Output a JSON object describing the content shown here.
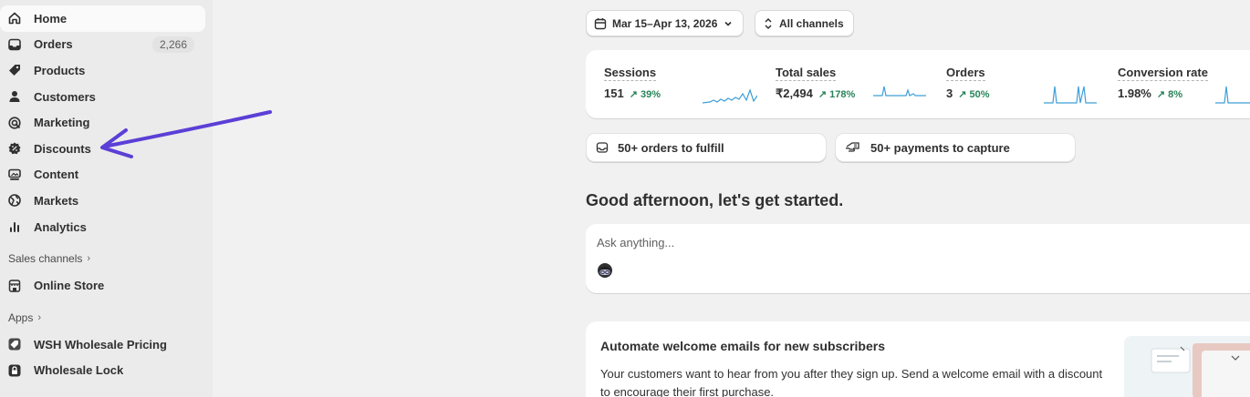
{
  "sidebar": {
    "items": [
      {
        "label": "Home",
        "icon": "home-icon"
      },
      {
        "label": "Orders",
        "icon": "inbox-icon",
        "badge": "2,266"
      },
      {
        "label": "Products",
        "icon": "tag-icon"
      },
      {
        "label": "Customers",
        "icon": "person-icon"
      },
      {
        "label": "Marketing",
        "icon": "target-icon"
      },
      {
        "label": "Discounts",
        "icon": "discount-icon"
      },
      {
        "label": "Content",
        "icon": "content-icon"
      },
      {
        "label": "Markets",
        "icon": "globe-icon"
      },
      {
        "label": "Analytics",
        "icon": "bar-chart-icon"
      }
    ],
    "sales_channels": {
      "heading": "Sales channels",
      "items": [
        {
          "label": "Online Store",
          "icon": "store-icon"
        }
      ]
    },
    "apps": {
      "heading": "Apps",
      "items": [
        {
          "label": "WSH Wholesale Pricing",
          "icon": "app-icon"
        },
        {
          "label": "Wholesale Lock",
          "icon": "lock-icon"
        }
      ]
    }
  },
  "filters": {
    "date": "Mar 15–Apr 13, 2026",
    "channels": "All channels"
  },
  "metrics": [
    {
      "label": "Sessions",
      "value": "151",
      "delta": "39%"
    },
    {
      "label": "Total sales",
      "value": "₹2,494",
      "delta": "178%"
    },
    {
      "label": "Orders",
      "value": "3",
      "delta": "50%"
    },
    {
      "label": "Conversion rate",
      "value": "1.98%",
      "delta": "8%"
    }
  ],
  "tasks": {
    "orders": "50+ orders to fulfill",
    "payments": "50+ payments to capture"
  },
  "greeting": "Good afternoon, let's get started.",
  "ask": {
    "placeholder": "Ask anything..."
  },
  "card": {
    "title": "Automate welcome emails for new subscribers",
    "body": "Your customers want to hear from you after they sign up. Send a welcome email with a discount to encourage their first purchase."
  },
  "colors": {
    "accent_arrow": "#5b3fd6",
    "positive": "#29845a",
    "sparkline": "#3f9fd8"
  }
}
